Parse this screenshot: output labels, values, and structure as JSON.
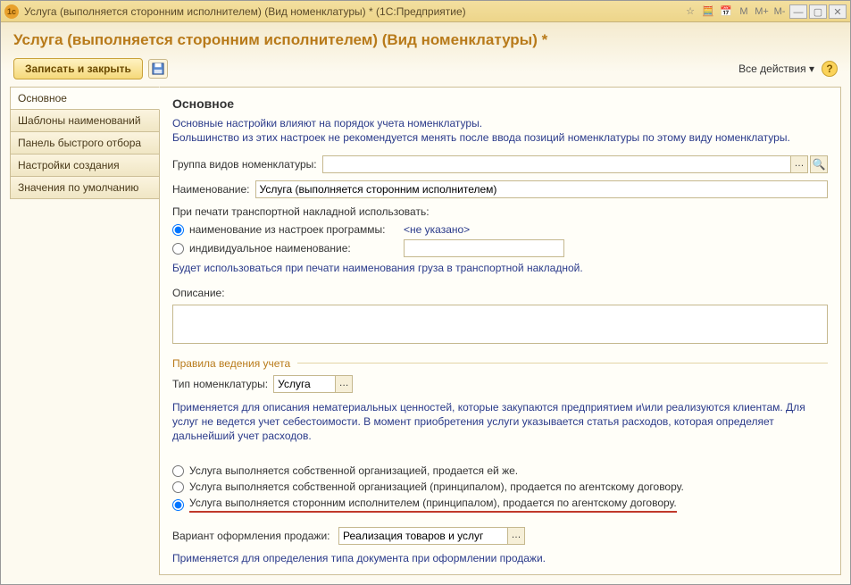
{
  "titlebar": {
    "title": "Услуга (выполняется сторонним исполнителем) (Вид номенклатуры) *  (1С:Предприятие)",
    "right_labels": [
      "M",
      "M+",
      "M-"
    ]
  },
  "header": {
    "title": "Услуга (выполняется сторонним исполнителем) (Вид номенклатуры) *"
  },
  "toolbar": {
    "save_close": "Записать и закрыть",
    "all_actions": "Все действия"
  },
  "sidebar": {
    "items": [
      {
        "label": "Основное"
      },
      {
        "label": "Шаблоны наименований"
      },
      {
        "label": "Панель быстрого отбора"
      },
      {
        "label": "Настройки создания"
      },
      {
        "label": "Значения по умолчанию"
      }
    ]
  },
  "main": {
    "heading": "Основное",
    "hint": "Основные настройки влияют на порядок учета номенклатуры.\nБольшинство из этих настроек не рекомендуется менять после ввода позиций номенклатуры по этому виду номенклатуры.",
    "group_label": "Группа видов номенклатуры:",
    "group_value": "",
    "name_label": "Наименование:",
    "name_value": "Услуга (выполняется сторонним исполнителем)",
    "print_label": "При печати транспортной накладной использовать:",
    "radio_print": [
      {
        "label": "наименование из настроек программы:",
        "link": "<не указано>"
      },
      {
        "label": "индивидуальное наименование:",
        "value": ""
      }
    ],
    "print_hint": "Будет использоваться при печати наименования груза в транспортной накладной.",
    "desc_label": "Описание:",
    "desc_value": "",
    "rules_legend": "Правила ведения учета",
    "type_label": "Тип номенклатуры:",
    "type_value": "Услуга",
    "type_hint": "Применяется для описания нематериальных ценностей, которые закупаются предприятием и\\или реализуются клиентам. Для услуг не ведется учет себестоимости. В момент приобретения услуги указывается статья расходов, которая определяет дальнейший учет расходов.",
    "service_options": [
      "Услуга выполняется собственной организацией, продается ей же.",
      "Услуга выполняется собственной организацией (принципалом), продается по агентскому договору.",
      "Услуга выполняется сторонним исполнителем (принципалом), продается по агентскому договору."
    ],
    "sale_variant_label": "Вариант оформления продажи:",
    "sale_variant_value": "Реализация товаров и услуг",
    "sale_variant_hint": "Применяется для определения типа документа при оформлении продажи."
  }
}
